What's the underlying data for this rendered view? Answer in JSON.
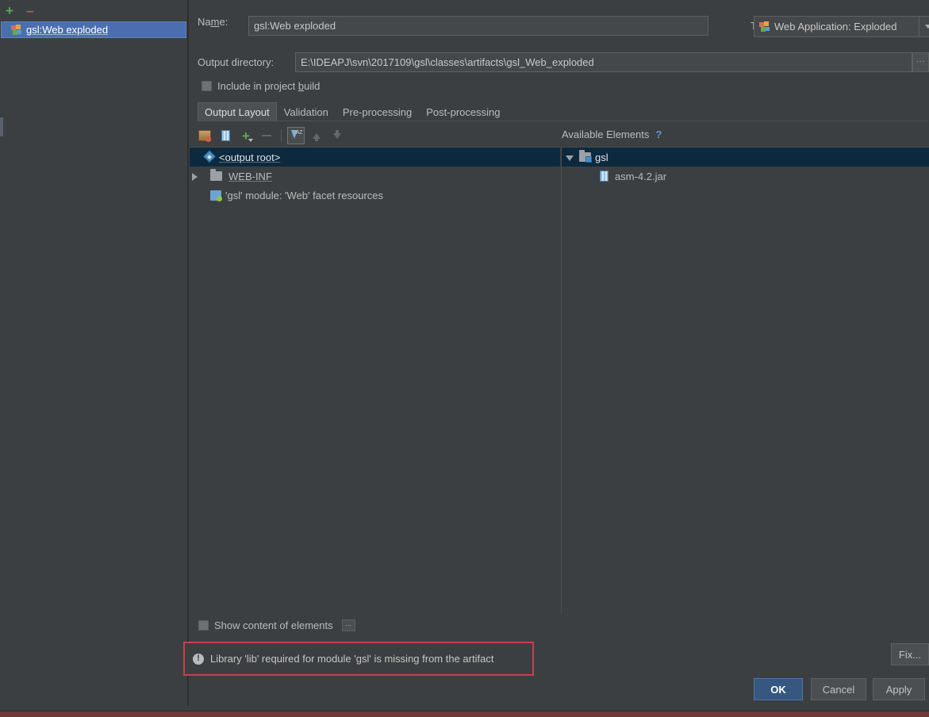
{
  "left_panel": {
    "toolbar": {
      "add_label": "+",
      "remove_label": "–",
      "add_icon": "plus-icon",
      "remove_icon": "minus-icon"
    },
    "artifacts": [
      {
        "label": "gsl:Web exploded",
        "icon": "artifact-exploded-icon",
        "selected": true
      }
    ]
  },
  "form": {
    "name_label": "Name:",
    "name_value": "gsl:Web exploded",
    "type_label": "Type:",
    "type_value": "Web Application: Exploded",
    "type_icon": "artifact-exploded-icon",
    "output_dir_label": "Output directory:",
    "output_dir_value": "E:\\IDEAPJ\\svn\\2017109\\gsl\\classes\\artifacts\\gsl_Web_exploded",
    "browse_label": "...",
    "include_in_build_label": "Include in project build",
    "include_in_build_checked": false
  },
  "tabs": [
    {
      "label": "Output Layout",
      "active": true
    },
    {
      "label": "Validation",
      "active": false
    },
    {
      "label": "Pre-processing",
      "active": false
    },
    {
      "label": "Post-processing",
      "active": false
    }
  ],
  "element_toolbar": [
    {
      "name": "add-directory-button",
      "icon": "folder-add-icon",
      "enabled": true,
      "pressed": false
    },
    {
      "name": "add-library-button",
      "icon": "jar-library-icon",
      "enabled": true,
      "pressed": false
    },
    {
      "name": "add-copy-button",
      "icon": "plus-dropdown-icon",
      "enabled": true,
      "pressed": false
    },
    {
      "name": "remove-button",
      "icon": "minus-icon",
      "enabled": false,
      "pressed": false
    },
    {
      "name": "sort-button",
      "icon": "sort-az-icon",
      "enabled": true,
      "pressed": true
    },
    {
      "name": "move-up-button",
      "icon": "arrow-up-icon",
      "enabled": false,
      "pressed": false
    },
    {
      "name": "move-down-button",
      "icon": "arrow-down-icon",
      "enabled": false,
      "pressed": false
    }
  ],
  "output_tree": [
    {
      "label": "<output root>",
      "icon": "output-root-icon",
      "selected": true,
      "indent": 0,
      "twisty": "none",
      "underline": true
    },
    {
      "label": "WEB-INF",
      "icon": "folder-icon",
      "selected": false,
      "indent": 0,
      "twisty": "collapsed",
      "underline": true
    },
    {
      "label": "'gsl' module: 'Web' facet resources",
      "icon": "module-facet-icon",
      "selected": false,
      "indent": 1,
      "twisty": "none",
      "underline": false
    }
  ],
  "available": {
    "header_label": "Available Elements",
    "help_icon": "help-icon",
    "help_label": "?",
    "tree": [
      {
        "label": "gsl",
        "icon": "module-folder-icon",
        "selected": true,
        "indent": 0,
        "twisty": "expanded"
      },
      {
        "label": "asm-4.2.jar",
        "icon": "jar-file-icon",
        "selected": false,
        "indent": 2,
        "twisty": "none"
      }
    ]
  },
  "bottom": {
    "show_content_label": "Show content of elements",
    "show_content_checked": false,
    "show_content_browse_label": "...",
    "error_icon": "warning-icon",
    "error_glyph": "!",
    "error_message": "Library 'lib' required for module 'gsl' is missing from the artifact",
    "fix_label": "Fix..."
  },
  "footer": {
    "ok_label": "OK",
    "cancel_label": "Cancel",
    "apply_label": "Apply"
  },
  "colors": {
    "accent_selection": "#4b6eaf",
    "tree_selection": "#0d293e",
    "error_border": "#c9404a",
    "ok_button": "#365880",
    "add_green": "#5fa84f",
    "remove_red": "#c75450",
    "background": "#3c3f41"
  }
}
